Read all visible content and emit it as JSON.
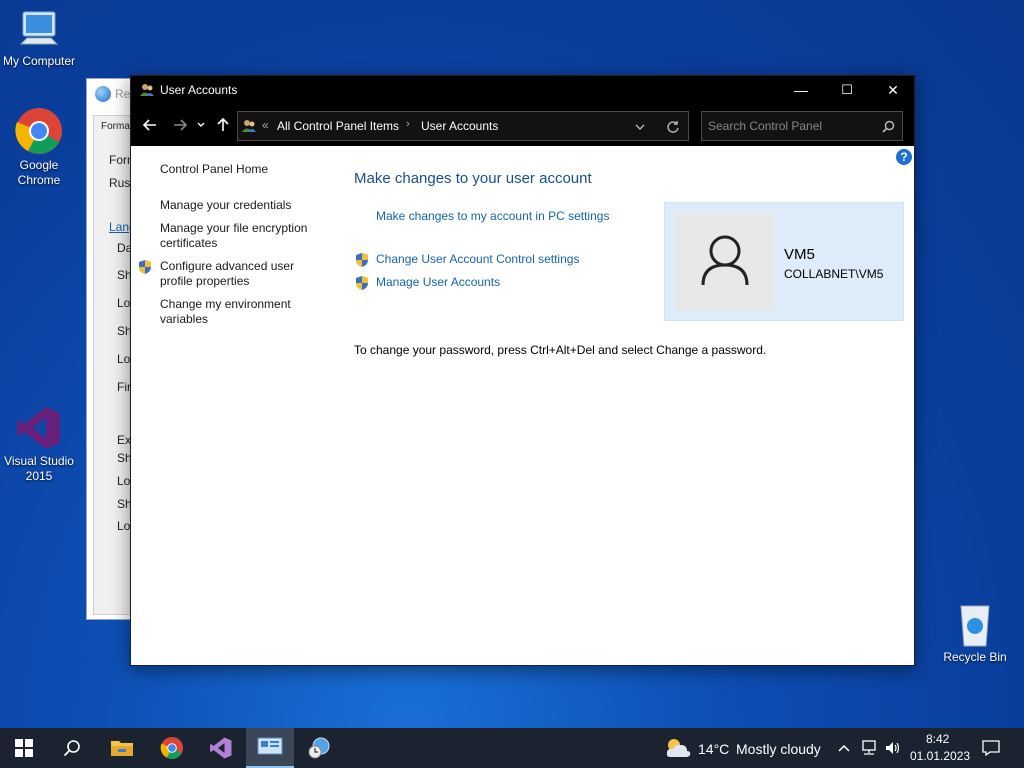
{
  "desktop": {
    "icons": [
      {
        "label": "My Computer"
      },
      {
        "label": "Google Chrome"
      },
      {
        "label": "Visual Studio 2015"
      },
      {
        "label": "Recycle Bin"
      }
    ]
  },
  "background_window": {
    "title": "Re",
    "tab": "Forma",
    "lines": [
      "Forn",
      "Rus",
      "Lang",
      "Da",
      "Sh",
      "Lo",
      "Sh",
      "Lo",
      "Fir",
      "Ex",
      "Sh",
      "Lo",
      "Sh",
      "Lo"
    ]
  },
  "window": {
    "title": "User Accounts",
    "controls": {
      "minimize": "—",
      "maximize": "☐",
      "close": "✕"
    },
    "breadcrumb": {
      "prefix": "«",
      "items": [
        "All Control Panel Items",
        "User Accounts"
      ]
    },
    "search": {
      "placeholder": "Search Control Panel"
    }
  },
  "sidebar": {
    "items": [
      {
        "label": "Control Panel Home"
      },
      {
        "label": "Manage your credentials"
      },
      {
        "label": "Manage your file encryption certificates"
      },
      {
        "label": "Configure advanced user profile properties"
      },
      {
        "label": "Change my environment variables"
      }
    ]
  },
  "main": {
    "heading": "Make changes to your user account",
    "links": [
      {
        "label": "Make changes to my account in PC settings"
      },
      {
        "label": "Change User Account Control settings"
      },
      {
        "label": "Manage User Accounts"
      }
    ],
    "password_note": "To change your password, press Ctrl+Alt+Del and select Change a password."
  },
  "user": {
    "name": "VM5",
    "domain": "COLLABNET\\VM5"
  },
  "taskbar": {
    "weather": {
      "temp": "14°C",
      "condition": "Mostly cloudy"
    },
    "clock": {
      "time": "8:42",
      "date": "01.01.2023"
    }
  },
  "colors": {
    "link": "#1565a8",
    "heading": "#1b4e8f",
    "card": "#deebf9",
    "titlebar": "#000000"
  }
}
